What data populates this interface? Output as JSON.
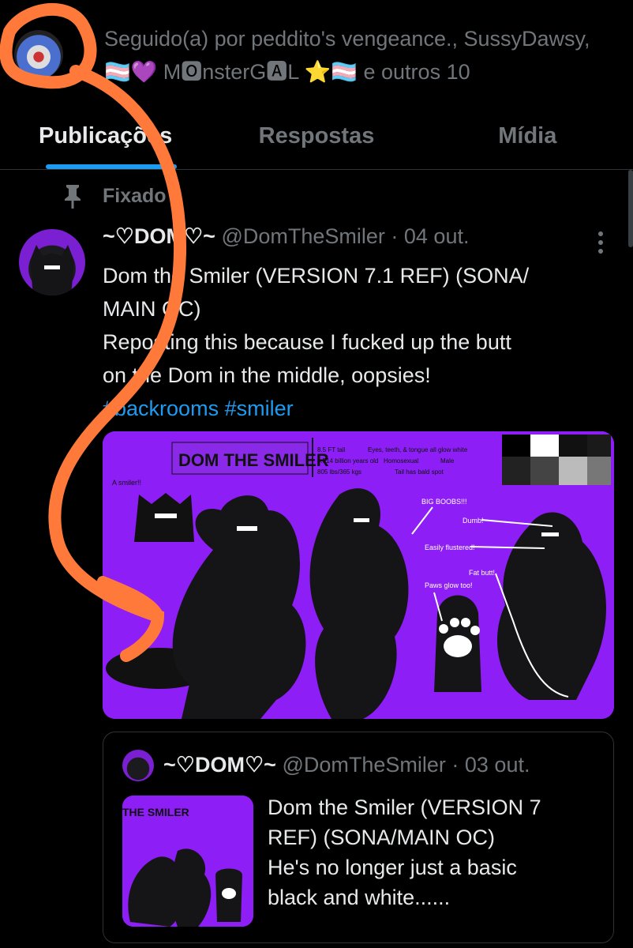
{
  "followers": {
    "line1": "Seguido(a) por peddito's vengeance., SussyDawsy,",
    "line2": "🏳️‍⚧️💜 M🅾nsterG🅰L ⭐🏳️‍⚧️ e outros 10"
  },
  "tabs": [
    {
      "label": "Publicações"
    },
    {
      "label": "Respostas"
    },
    {
      "label": "Mídia"
    }
  ],
  "pinned": {
    "label": "Fixado"
  },
  "tweet": {
    "name": "~♡DOM♡~",
    "meta": "@DomTheSmiler · 04 out.",
    "line1": "Dom the Smiler (VERSION 7.1 REF) (SONA/",
    "line2": "MAIN OC)",
    "line3": "Reposting this because I fucked up the butt",
    "line4": "on the Dom in the middle, oopsies!",
    "hashtags": "#backrooms #smiler",
    "image": {
      "title": "DOM THE SMILER",
      "stats": [
        "8.5 FT tall",
        "4.514 billion years old",
        "805 lbs/365 kgs",
        "Eyes, teeth, & tongue all glow white",
        "Homosexual",
        "Male",
        "Tail has bald spot"
      ],
      "notes": [
        "A smiler!!",
        "BIG BOOBS!!!",
        "Dumb!",
        "Easily flustered!",
        "Fat butt!",
        "Paws glow too!"
      ]
    }
  },
  "quote": {
    "name": "~♡DOM♡~",
    "meta": "@DomTheSmiler · 03 out.",
    "line1": "Dom the Smiler (VERSION 7",
    "line2": "REF) (SONA/MAIN OC)",
    "line3": "He's no longer just a basic",
    "line4": "black and white......",
    "thumb_title": "THE SMILER"
  },
  "colors": {
    "accent": "#1d9bf0",
    "muted": "#71767b",
    "image_bg": "#8d1ef5",
    "scribble": "#ff7a3a"
  }
}
